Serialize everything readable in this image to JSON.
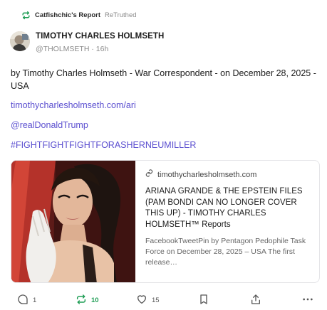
{
  "retruth": {
    "icon": "retruth-icon",
    "account_name": "Catfishchic's Report",
    "label": "ReTruthed"
  },
  "author": {
    "display_name": "TIMOTHY CHARLES HOLMSETH",
    "handle": "@THOLMSETH",
    "separator": "·",
    "time_ago": "16h"
  },
  "post": {
    "text": "by Timothy Charles Holmseth - War Correspondent - on December 28, 2025 - USA",
    "link": "timothycharlesholmseth.com/ari",
    "mention": "@realDonaldTrump",
    "hashtag": "#FIGHTFIGHTFIGHTFORASHERNEUMILLER"
  },
  "card": {
    "domain": "timothycharlesholmseth.com",
    "title": "ARIANA GRANDE & THE EPSTEIN FILES (PAM BONDI CAN NO LONGER COVER THIS UP) - TIMOTHY CHARLES HOLMSETH™ Reports",
    "description": "FacebookTweetPin by Pentagon Pedophile Task Force on December 28, 2025 – USA The first release…"
  },
  "actions": {
    "replies": "1",
    "retruths": "10",
    "likes": "15",
    "retruth_color": "#1f9d55",
    "icons": [
      "reply-icon",
      "retruth-icon",
      "heart-icon",
      "bookmark-icon",
      "share-icon",
      "more-icon"
    ]
  },
  "colors": {
    "link": "#5b4fd0",
    "muted": "#8a8a8a",
    "accent_green": "#1f9d55"
  }
}
